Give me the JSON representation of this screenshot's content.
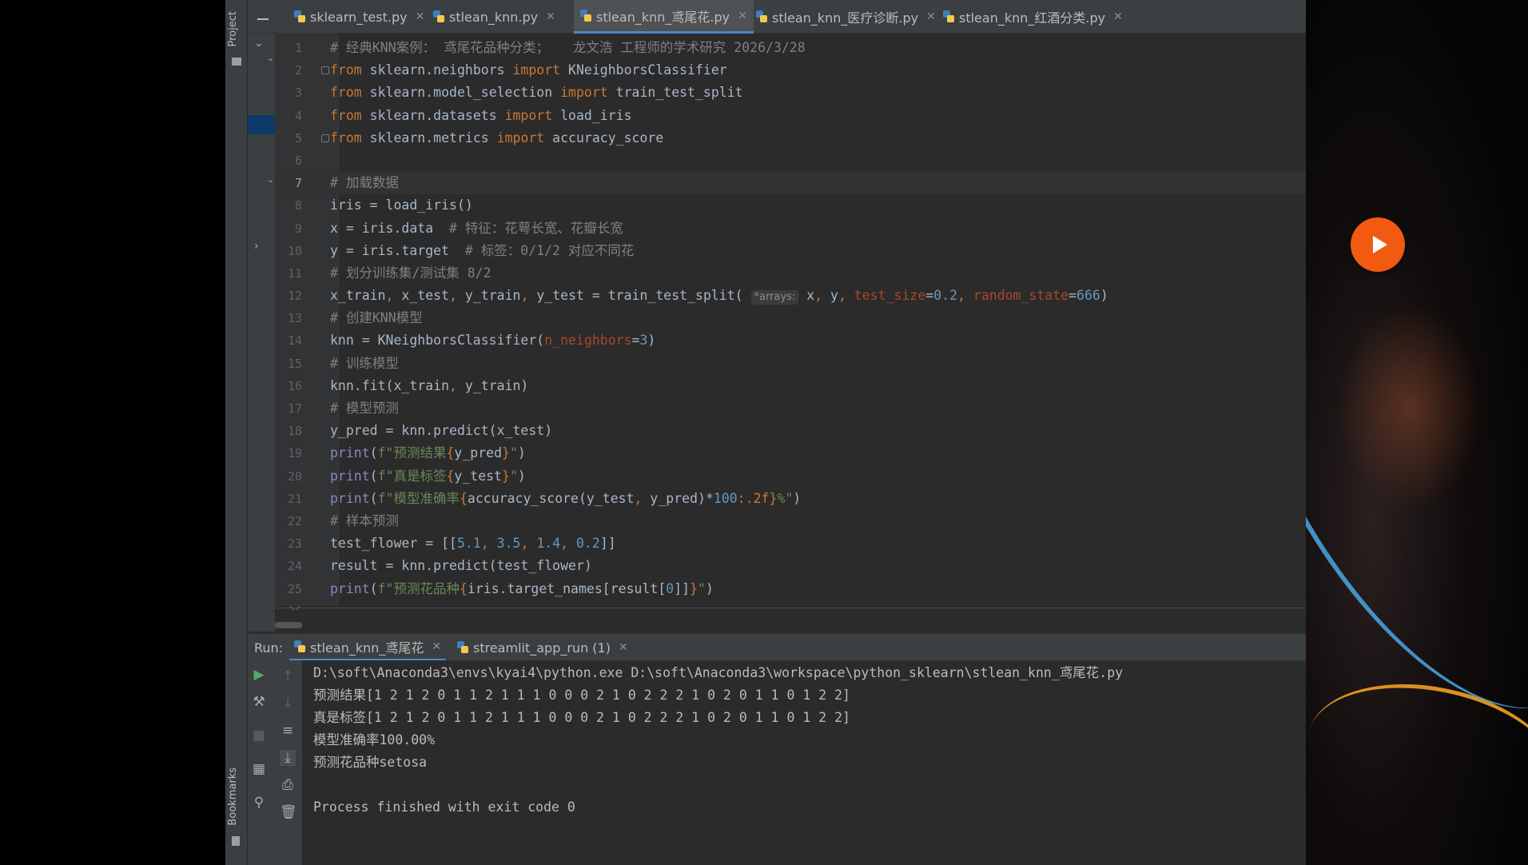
{
  "tabs": [
    {
      "label": "sklearn_test.py",
      "active": false
    },
    {
      "label": "stlean_knn.py",
      "active": false
    },
    {
      "label": "stlean_knn_鸢尾花.py",
      "active": true
    },
    {
      "label": "stlean_knn_医疗诊断.py",
      "active": false
    },
    {
      "label": "stlean_knn_红酒分类.py",
      "active": false
    }
  ],
  "sidebar": {
    "project_label": "Project",
    "bookmarks_label": "Bookmarks"
  },
  "editor": {
    "current_line": 7,
    "line_numbers": [
      "1",
      "2",
      "3",
      "4",
      "5",
      "6",
      "7",
      "8",
      "9",
      "10",
      "11",
      "12",
      "13",
      "14",
      "15",
      "16",
      "17",
      "18",
      "19",
      "20",
      "21",
      "22",
      "23",
      "24",
      "25",
      "26"
    ],
    "param_hint": "*arrays:"
  },
  "run": {
    "label": "Run:",
    "tabs": [
      "stlean_knn_鸢尾花",
      "streamlit_app_run (1)"
    ],
    "output": [
      "D:\\soft\\Anaconda3\\envs\\kyai4\\python.exe D:\\soft\\Anaconda3\\workspace\\python_sklearn\\stlean_knn_鸢尾花.py",
      "预测结果[1 2 1 2 0 1 1 2 1 1 1 0 0 0 2 1 0 2 2 2 1 0 2 0 1 1 0 1 2 2]",
      "真是标签[1 2 1 2 0 1 1 2 1 1 1 0 0 0 2 1 0 2 2 2 1 0 2 0 1 1 0 1 2 2]",
      "模型准确率100.00%",
      "预测花品种setosa",
      "",
      "Process finished with exit code 0"
    ]
  },
  "colors": {
    "accent": "#4a88c7",
    "keyword": "#cc7832",
    "play_button": "#f25a12"
  },
  "icons": [
    "python-file-icon",
    "close-icon",
    "play-icon",
    "wrench-icon",
    "stop-icon",
    "layout-icon",
    "pin-icon",
    "arrow-up-icon",
    "arrow-down-icon",
    "soft-wrap-icon",
    "scroll-to-end-icon",
    "print-icon",
    "trash-icon",
    "folder-icon",
    "bookmark-icon"
  ]
}
